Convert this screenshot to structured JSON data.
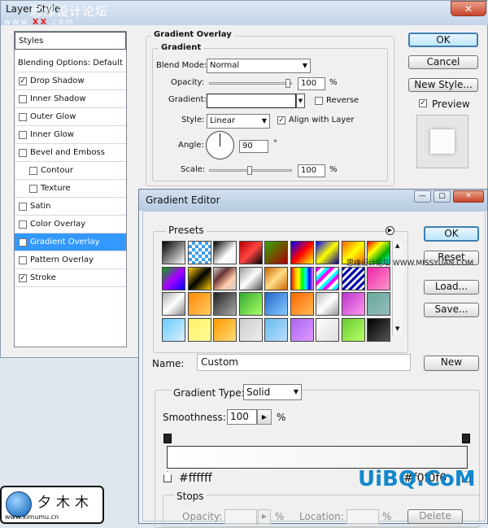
{
  "layer_style": {
    "title": "Layer Style",
    "watermark_top": "思缘设计论坛",
    "watermark_sub": "www.",
    "watermark_red": "XX",
    "watermark_tail": ".com",
    "close_glyph": "✕",
    "styles_list": {
      "header": "Styles",
      "items": [
        {
          "label": "Blending Options: Default",
          "checkbox": false,
          "checked": false,
          "indent": 0,
          "selected": false
        },
        {
          "label": "Drop Shadow",
          "checkbox": true,
          "checked": true,
          "indent": 0,
          "selected": false
        },
        {
          "label": "Inner Shadow",
          "checkbox": true,
          "checked": false,
          "indent": 0,
          "selected": false
        },
        {
          "label": "Outer Glow",
          "checkbox": true,
          "checked": false,
          "indent": 0,
          "selected": false
        },
        {
          "label": "Inner Glow",
          "checkbox": true,
          "checked": false,
          "indent": 0,
          "selected": false
        },
        {
          "label": "Bevel and Emboss",
          "checkbox": true,
          "checked": false,
          "indent": 0,
          "selected": false
        },
        {
          "label": "Contour",
          "checkbox": true,
          "checked": false,
          "indent": 1,
          "selected": false
        },
        {
          "label": "Texture",
          "checkbox": true,
          "checked": false,
          "indent": 1,
          "selected": false
        },
        {
          "label": "Satin",
          "checkbox": true,
          "checked": false,
          "indent": 0,
          "selected": false
        },
        {
          "label": "Color Overlay",
          "checkbox": true,
          "checked": false,
          "indent": 0,
          "selected": false
        },
        {
          "label": "Gradient Overlay",
          "checkbox": true,
          "checked": true,
          "indent": 0,
          "selected": true
        },
        {
          "label": "Pattern Overlay",
          "checkbox": true,
          "checked": false,
          "indent": 0,
          "selected": false
        },
        {
          "label": "Stroke",
          "checkbox": true,
          "checked": true,
          "indent": 0,
          "selected": false
        }
      ]
    },
    "panel": {
      "outer_title": "Gradient Overlay",
      "inner_title": "Gradient",
      "blend_mode_label": "Blend Mode:",
      "blend_mode_value": "Normal",
      "opacity_label": "Opacity:",
      "opacity_value": "100",
      "opacity_level": 1.0,
      "percent": "%",
      "gradient_label": "Gradient:",
      "reverse_label": "Reverse",
      "reverse_checked": false,
      "style_label": "Style:",
      "style_value": "Linear",
      "align_label": "Align with Layer",
      "align_checked": true,
      "angle_label": "Angle:",
      "angle_value": "90",
      "degree": "°",
      "scale_label": "Scale:",
      "scale_value": "100",
      "scale_level": 0.5
    },
    "buttons": {
      "ok": "OK",
      "cancel": "Cancel",
      "new_style": "New Style...",
      "preview_label": "Preview",
      "preview_checked": true
    }
  },
  "gradient_editor": {
    "title": "Gradient Editor",
    "presets_label": "Presets",
    "ok": "OK",
    "reset": "Reset",
    "load": "Load...",
    "save": "Save...",
    "name_label": "Name:",
    "name_value": "Custom",
    "new": "New",
    "gradient_type_label": "Gradient Type:",
    "gradient_type_value": "Solid",
    "smoothness_label": "Smoothness:",
    "smoothness_value": "100",
    "percent": "%",
    "left_stop_color": "#ffffff",
    "right_stop_color": "#f0f0f0",
    "stops_label": "Stops",
    "opacity_label": "Opacity:",
    "location_label": "Location:",
    "delete_label": "Delete",
    "side_watermark": "思缘设计论坛 WWW.MISSYUAN.COM"
  },
  "logo": {
    "text": "夕木木",
    "url": "www.ximumu.cn"
  },
  "corner_watermark": "UiBQ.CoM"
}
